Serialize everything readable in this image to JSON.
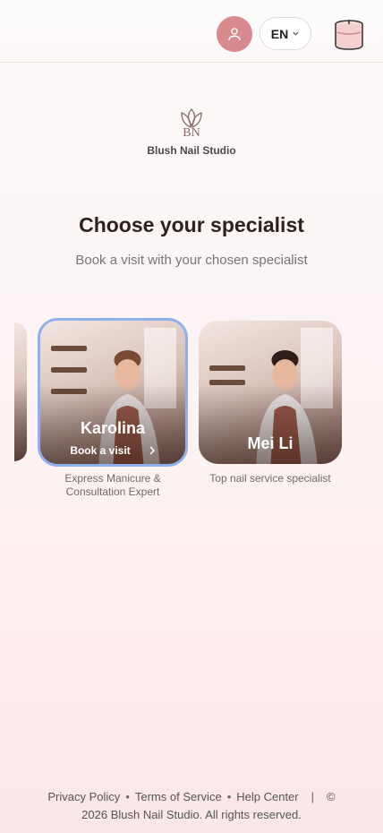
{
  "header": {
    "account_icon": "user-icon",
    "language": "EN",
    "cart_icon": "candle-cart-icon"
  },
  "brand": {
    "monogram": "BN",
    "name": "Blush Nail Studio"
  },
  "page": {
    "title": "Choose your specialist",
    "subtitle": "Book a visit with your chosen specialist"
  },
  "specialists": [
    {
      "name": "Karolina",
      "action": "Book a visit",
      "description": "Express Manicure & Consultation Expert",
      "selected": true
    },
    {
      "name": "Mei Li",
      "description": "Top nail service specialist",
      "selected": false
    }
  ],
  "footer": {
    "links": [
      "Privacy Policy",
      "Terms of Service",
      "Help Center"
    ],
    "copyright_line1": "©",
    "copyright_line2": "2026 Blush Nail Studio. All rights reserved."
  },
  "colors": {
    "accent": "#d98a8f",
    "selected_border": "#8fb0ef"
  }
}
